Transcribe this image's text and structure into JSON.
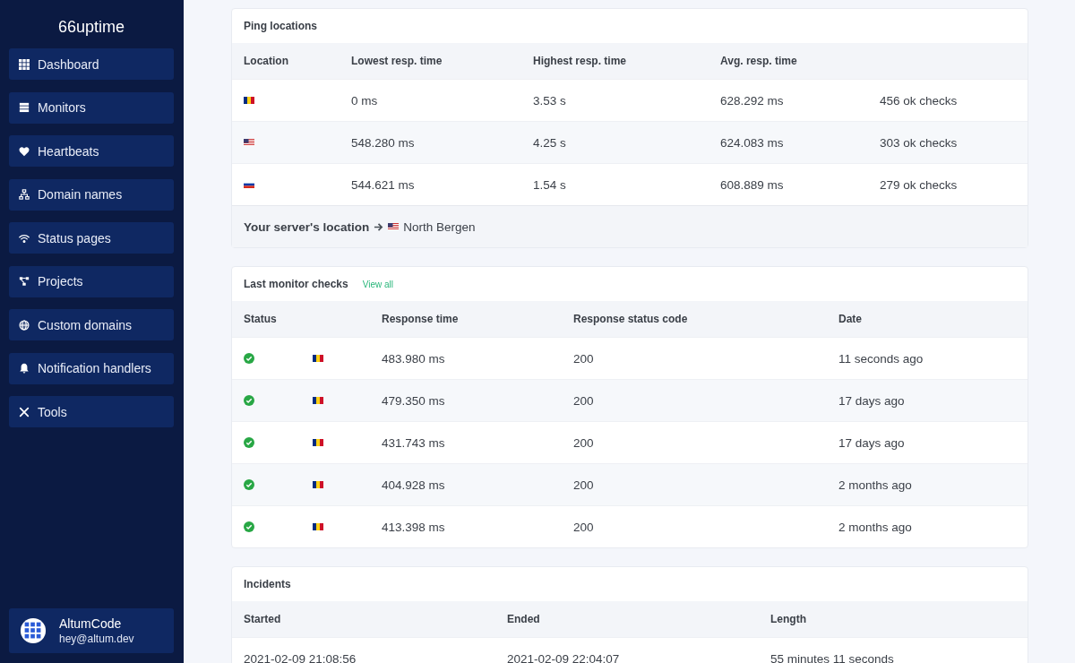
{
  "sidebar": {
    "brand": "66uptime",
    "items": [
      {
        "label": "Dashboard"
      },
      {
        "label": "Monitors"
      },
      {
        "label": "Heartbeats"
      },
      {
        "label": "Domain names"
      },
      {
        "label": "Status pages"
      },
      {
        "label": "Projects"
      },
      {
        "label": "Custom domains"
      },
      {
        "label": "Notification handlers"
      },
      {
        "label": "Tools"
      }
    ],
    "user": {
      "name": "AltumCode",
      "email": "hey@altum.dev"
    }
  },
  "ping_locations": {
    "title": "Ping locations",
    "columns": [
      "Location",
      "Lowest resp. time",
      "Highest resp. time",
      "Avg. resp. time"
    ],
    "rows": [
      {
        "flag": {
          "kind": "romania"
        },
        "lowest": "0 ms",
        "highest": "3.53 s",
        "avg": "628.292 ms",
        "checks": "456 ok checks"
      },
      {
        "flag": {
          "kind": "usa"
        },
        "lowest": "548.280 ms",
        "highest": "4.25 s",
        "avg": "624.083 ms",
        "checks": "303 ok checks"
      },
      {
        "flag": {
          "kind": "russia"
        },
        "lowest": "544.621 ms",
        "highest": "1.54 s",
        "avg": "608.889 ms",
        "checks": "279 ok checks"
      }
    ],
    "server_label": "Your server's location",
    "server_flag": {
      "kind": "usa"
    },
    "server_city": "North Bergen"
  },
  "monitor_checks": {
    "title": "Last monitor checks",
    "link": "View all",
    "columns": [
      "Status",
      "Response time",
      "Response status code",
      "Date"
    ],
    "rows": [
      {
        "status": {
          "kind": "ok"
        },
        "flag": {
          "kind": "romania"
        },
        "response_time": "483.980 ms",
        "code": "200",
        "date": "11 seconds ago"
      },
      {
        "status": {
          "kind": "ok"
        },
        "flag": {
          "kind": "romania"
        },
        "response_time": "479.350 ms",
        "code": "200",
        "date": "17 days ago"
      },
      {
        "status": {
          "kind": "ok"
        },
        "flag": {
          "kind": "romania"
        },
        "response_time": "431.743 ms",
        "code": "200",
        "date": "17 days ago"
      },
      {
        "status": {
          "kind": "ok"
        },
        "flag": {
          "kind": "romania"
        },
        "response_time": "404.928 ms",
        "code": "200",
        "date": "2 months ago"
      },
      {
        "status": {
          "kind": "ok"
        },
        "flag": {
          "kind": "romania"
        },
        "response_time": "413.398 ms",
        "code": "200",
        "date": "2 months ago"
      }
    ]
  },
  "incidents": {
    "title": "Incidents",
    "columns": [
      "Started",
      "Ended",
      "Length"
    ],
    "rows": [
      {
        "started": "2021-02-09 21:08:56",
        "ended": "2021-02-09 22:04:07",
        "length": "55 minutes 11 seconds"
      }
    ]
  }
}
